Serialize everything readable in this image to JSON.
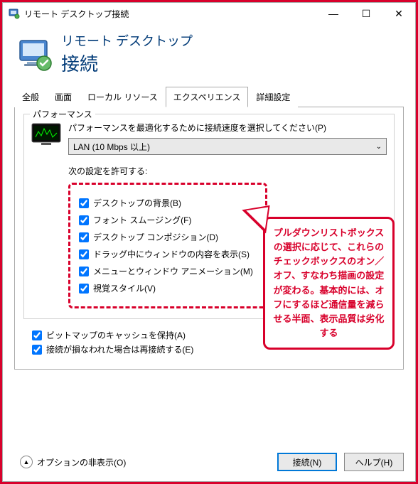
{
  "titlebar": {
    "text": "リモート デスクトップ接続"
  },
  "header": {
    "line1": "リモート デスクトップ",
    "line2": "接続"
  },
  "tabs": {
    "t0": "全般",
    "t1": "画面",
    "t2": "ローカル リソース",
    "t3": "エクスペリエンス",
    "t4": "詳細設定"
  },
  "perf": {
    "group_title": "パフォーマンス",
    "label": "パフォーマンスを最適化するために接続速度を選択してください(P)",
    "dropdown_value": "LAN (10 Mbps 以上)",
    "allow_label": "次の設定を許可する:"
  },
  "cb": {
    "c0": "デスクトップの背景(B)",
    "c1": "フォント スムージング(F)",
    "c2": "デスクトップ コンポジション(D)",
    "c3": "ドラッグ中にウィンドウの内容を表示(S)",
    "c4": "メニューとウィンドウ アニメーション(M)",
    "c5": "視覚スタイル(V)"
  },
  "extra": {
    "bitmap": "ビットマップのキャッシュを保持(A)",
    "reconnect": "接続が損なわれた場合は再接続する(E)"
  },
  "footer": {
    "options": "オプションの非表示(O)",
    "connect": "接続(N)",
    "help": "ヘルプ(H)"
  },
  "callout": {
    "text": "プルダウンリストボックスの選択に応じて、これらのチェックボックスのオン／オフ、すなわち描画の設定が変わる。基本的には、オフにするほど通信量を減らせる半面、表示品質は劣化する"
  }
}
